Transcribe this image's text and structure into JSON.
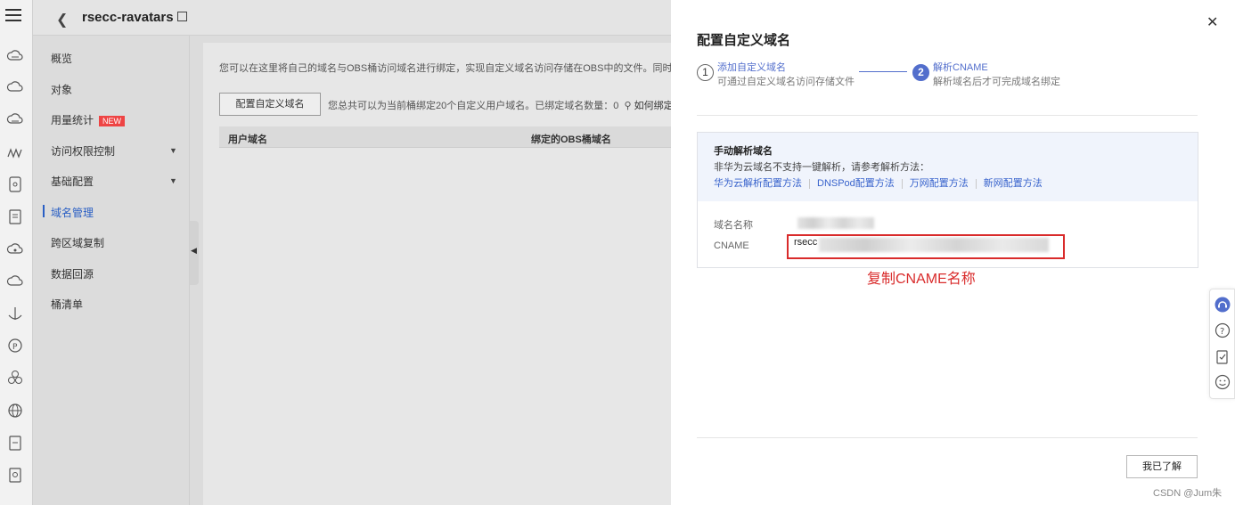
{
  "topbar": {
    "bucket_name": "rsecc-ravatars"
  },
  "subnav": {
    "items": [
      {
        "label": "概览"
      },
      {
        "label": "对象"
      },
      {
        "label": "用量统计",
        "badge": "NEW"
      },
      {
        "label": "访问权限控制"
      },
      {
        "label": "基础配置"
      },
      {
        "label": "域名管理"
      },
      {
        "label": "跨区域复制"
      },
      {
        "label": "数据回源"
      },
      {
        "label": "桶清单"
      }
    ],
    "active": "域名管理"
  },
  "main": {
    "description": "您可以在这里将自己的域名与OBS桶访问域名进行绑定，实现自定义域名访问存储在OBS中的文件。同时",
    "config_button": "配置自定义域名",
    "info": "您总共可以为当前桶绑定20个自定义用户域名。已绑定域名数量：0",
    "help_link": "如何绑定",
    "columns": [
      "用户域名",
      "绑定的OBS桶域名"
    ]
  },
  "drawer": {
    "title": "配置自定义域名",
    "steps": [
      {
        "num": "1",
        "title": "添加自定义域名",
        "desc": "可通过自定义域名访问存储文件"
      },
      {
        "num": "2",
        "title": "解析CNAME",
        "desc": "解析域名后才可完成域名绑定"
      }
    ],
    "manual": {
      "heading": "手动解析域名",
      "subtitle": "非华为云域名不支持一键解析，请参考解析方法：",
      "links": [
        "华为云解析配置方法",
        "DNSPod配置方法",
        "万网配置方法",
        "新网配置方法"
      ]
    },
    "fields": {
      "domain_label": "域名名称",
      "cname_label": "CNAME",
      "cname_value_visible": "rsecc"
    },
    "annotation": "复制CNAME名称",
    "confirm_button": "我已了解",
    "watermark": "CSDN @Jum朱"
  },
  "colors": {
    "accent": "#526ecc",
    "link": "#3863cc",
    "annotation_red": "#d92b2b"
  },
  "icons": [
    "menu-icon",
    "cloud-icon",
    "cloud-icon",
    "cloud-icon",
    "waves-icon",
    "file-icon",
    "doc-icon",
    "cloud-icon",
    "cloud-icon",
    "anchor-icon",
    "circle-p-icon",
    "cluster-icon",
    "globe-icon",
    "doc-icon",
    "doc-icon"
  ]
}
